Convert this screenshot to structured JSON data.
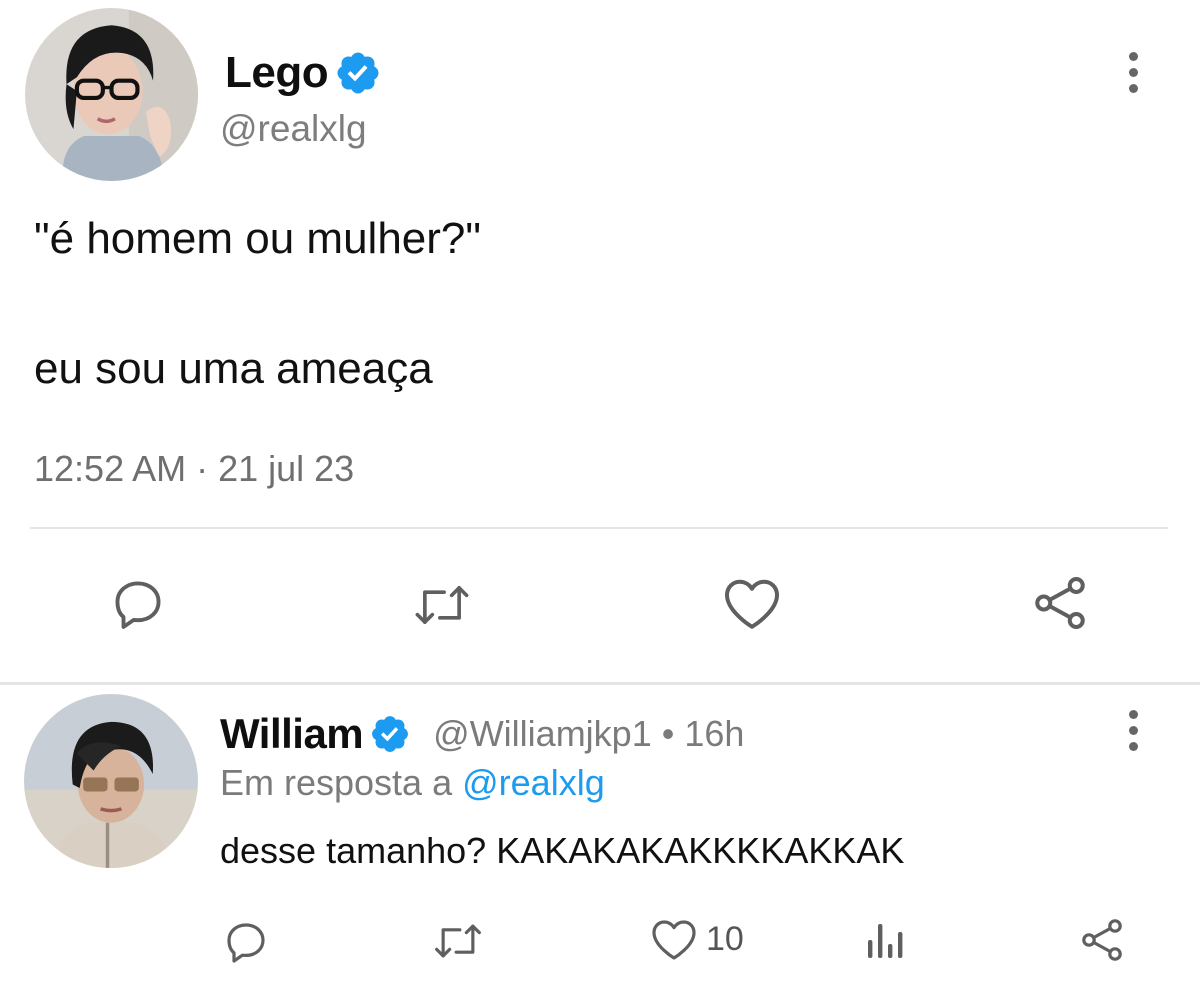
{
  "tweet": {
    "author_name": "Lego",
    "author_handle": "@realxlg",
    "text_line_1": "\"é homem ou mulher?\"",
    "text_line_2": "eu sou uma ameaça",
    "timestamp": "12:52 AM · 21 jul 23",
    "verified": true,
    "verified_color": "#1d9bf0",
    "icons": {
      "reply": "reply-icon",
      "retweet": "retweet-icon",
      "like": "heart-icon",
      "share": "share-icon",
      "more": "more-options-icon"
    }
  },
  "reply": {
    "author_name": "William",
    "handle_and_time": "@Williamjkp1 • 16h",
    "context_prefix": "Em resposta a",
    "context_mention": "@realxlg",
    "text": "desse tamanho? KAKAKAKAKKKKAKKAK",
    "like_count": "10",
    "verified": true,
    "mention_color": "#1d9bf0",
    "icons": {
      "reply": "reply-icon",
      "retweet": "retweet-icon",
      "like": "heart-icon",
      "views": "views-icon",
      "share": "share-icon",
      "more": "more-options-icon"
    }
  }
}
